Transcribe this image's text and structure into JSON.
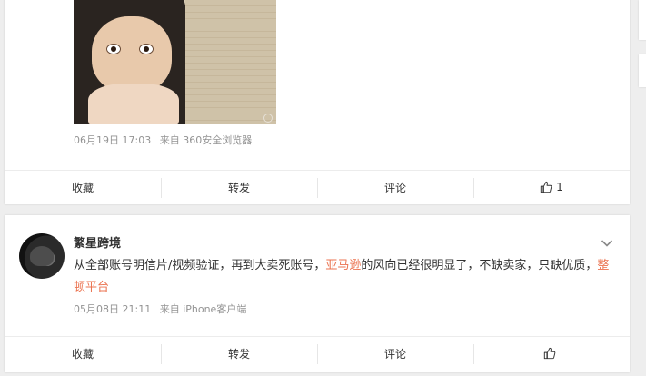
{
  "post1": {
    "date": "06月19日 17:03",
    "source": "来自 360安全浏览器",
    "actions": {
      "collect": "收藏",
      "repost": "转发",
      "comment": "评论",
      "like_count": "1"
    }
  },
  "post2": {
    "username": "繁星跨境",
    "text_part1": "从全部账号明信片/视频验证，再到大卖死账号，",
    "link1": "亚马逊",
    "text_part2": "的风向已经很明显了，不缺卖家，只缺优质，",
    "link2": "整顿平台",
    "date": "05月08日 21:11",
    "source": "来自 iPhone客户端",
    "actions": {
      "collect": "收藏",
      "repost": "转发",
      "comment": "评论"
    }
  },
  "colors": {
    "link": "#eb7350",
    "meta": "#939393",
    "background": "#eeeeee"
  },
  "icons": {
    "like": "thumbs-up-icon",
    "menu": "chevron-down-icon"
  }
}
